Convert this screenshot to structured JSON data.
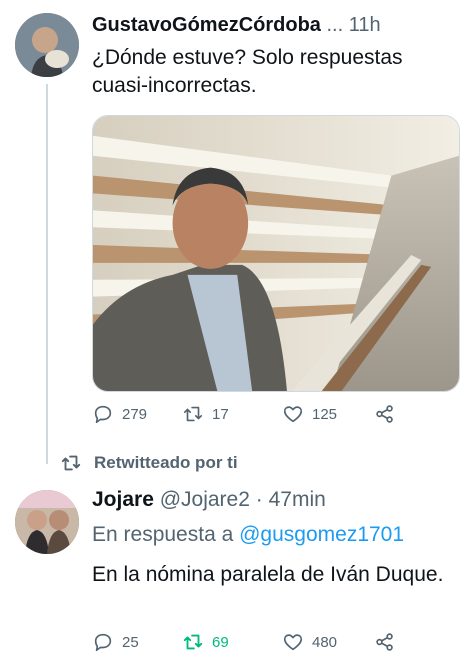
{
  "tweet1": {
    "author_name": "GustavoGómezCórdoba",
    "ellipsis": "...",
    "time": "11h",
    "text": "¿Dónde estuve? Solo respuestas cuasi-incorrectas.",
    "actions": {
      "replies": "279",
      "retweets": "17",
      "likes": "125"
    }
  },
  "retweet_banner": {
    "label": "Retwitteado por ti"
  },
  "tweet2": {
    "author_name": "Jojare",
    "handle": "@Jojare2",
    "separator": "·",
    "time": "47min",
    "reply_prefix": "En respuesta a",
    "reply_handle": "@gusgomez1701",
    "text": "En la nómina paralela de Iván Duque.",
    "actions": {
      "replies": "25",
      "retweets": "69",
      "likes": "480"
    }
  },
  "colors": {
    "muted": "#536471",
    "link": "#1d9bf0",
    "retweet_active": "#00ba7c",
    "divider": "#cfd9de"
  },
  "icons": [
    "reply-icon",
    "retweet-icon",
    "like-icon",
    "share-icon"
  ]
}
